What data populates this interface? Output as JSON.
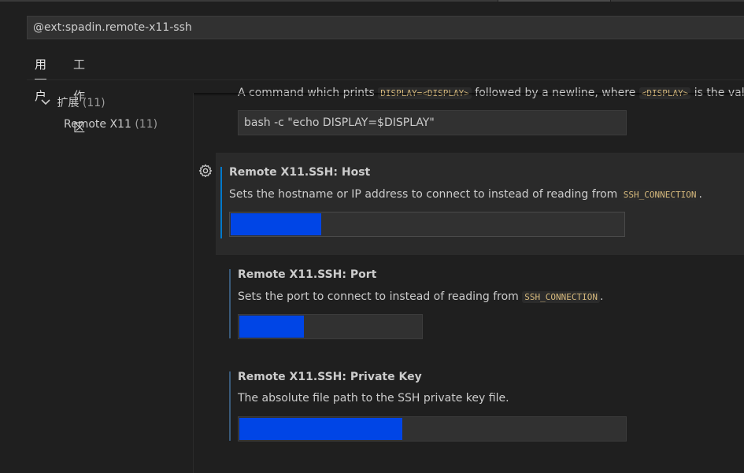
{
  "search": {
    "value": "@ext:spadin.remote-x11-ssh"
  },
  "tabs": [
    {
      "label": "用户"
    },
    {
      "label": "工作区"
    }
  ],
  "sidebar": {
    "category": {
      "label": "扩展",
      "count": "(11)"
    },
    "subitem": {
      "label": "Remote X11",
      "count": "(11)"
    }
  },
  "settings": {
    "display_command": {
      "description_pre": "A command which prints ",
      "code1": "DISPLAY=<DISPLAY>",
      "description_mid": " followed by a newline, where ",
      "code2": "<DISPLAY>",
      "description_post": " is the valu",
      "value": "bash -c \"echo DISPLAY=$DISPLAY\""
    },
    "host": {
      "category": "Remote X11.SSH: ",
      "name": "Host",
      "description_pre": "Sets the hostname or IP address to connect to instead of reading from ",
      "code": "SSH_CONNECTION",
      "description_post": ".",
      "fill_fraction": 0.23
    },
    "port": {
      "category": "Remote X11.SSH: ",
      "name": "Port",
      "description_pre": "Sets the port to connect to instead of reading from ",
      "code": "SSH_CONNECTION",
      "description_post": ".",
      "fill_fraction": 0.35
    },
    "private_key": {
      "category": "Remote X11.SSH: ",
      "name": "Private Key",
      "description": "The absolute file path to the SSH private key file.",
      "fill_fraction": 0.42
    }
  },
  "colors": {
    "accent": "#007acc",
    "selection_fill": "#0045e6",
    "background": "#1f1f1f"
  },
  "icons": {
    "gear": "gear-icon",
    "chevron": "chevron-down-icon"
  }
}
